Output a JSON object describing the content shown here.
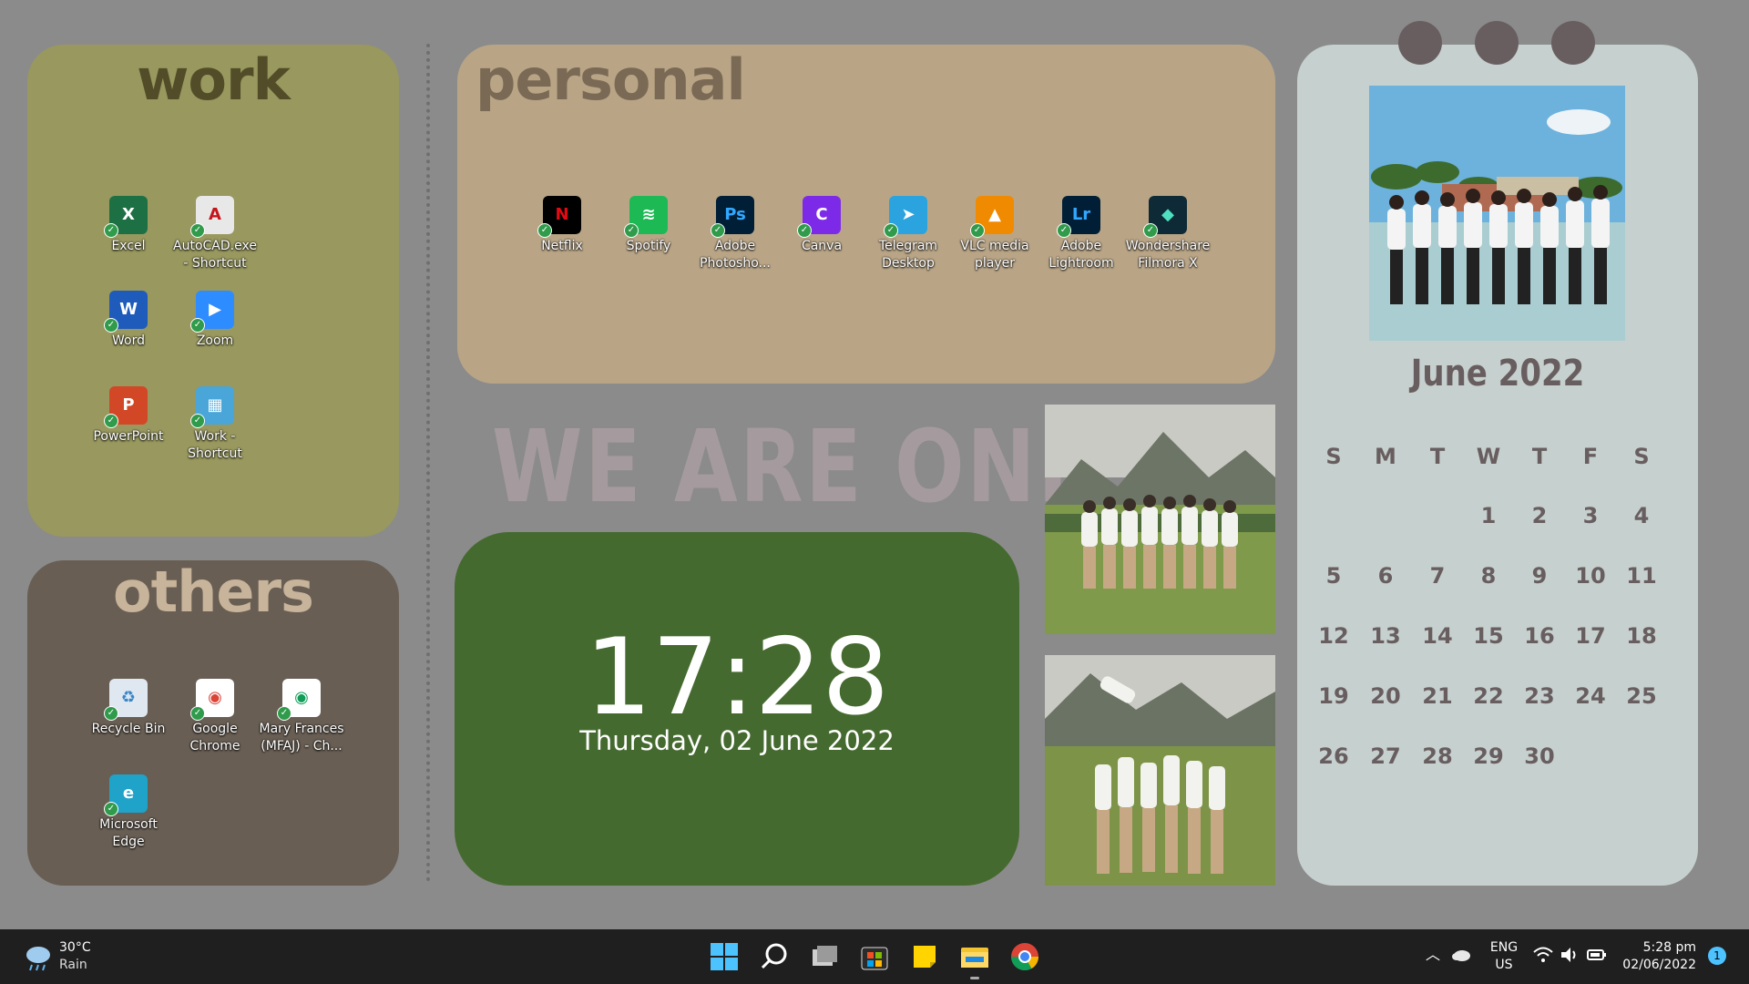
{
  "panels": {
    "work": {
      "title": "work",
      "icons": [
        {
          "label": "Excel",
          "glyph": "X",
          "color": "#1d7044",
          "name": "excel"
        },
        {
          "label": "AutoCAD.exe\n- Shortcut",
          "glyph": "A",
          "color": "#e8e8e8",
          "fg": "#c4161c",
          "name": "autocad"
        },
        {
          "label": "Word",
          "glyph": "W",
          "color": "#1e5bbb",
          "name": "word"
        },
        {
          "label": "Zoom",
          "glyph": "▶",
          "color": "#2d8cff",
          "name": "zoom"
        },
        {
          "label": "PowerPoint",
          "glyph": "P",
          "color": "#d24726",
          "name": "powerpoint"
        },
        {
          "label": "Work -\nShortcut",
          "glyph": "▦",
          "color": "#4aa6d8",
          "name": "work-shortcut"
        }
      ]
    },
    "others": {
      "title": "others",
      "icons": [
        {
          "label": "Recycle Bin",
          "glyph": "♻",
          "color": "#dfe8f0",
          "fg": "#3a87c7",
          "name": "recycle-bin"
        },
        {
          "label": "Google\nChrome",
          "glyph": "◉",
          "color": "#ffffff",
          "fg": "#db4437",
          "name": "google-chrome"
        },
        {
          "label": "Mary Frances\n(MFAJ) - Ch...",
          "glyph": "◉",
          "color": "#ffffff",
          "fg": "#0f9d58",
          "name": "chrome-profile"
        },
        {
          "label": "Microsoft\nEdge",
          "glyph": "e",
          "color": "#1fa3c9",
          "name": "microsoft-edge"
        }
      ]
    },
    "personal": {
      "title": "personal",
      "icons": [
        {
          "label": "Netflix",
          "glyph": "N",
          "color": "#000000",
          "fg": "#e50914",
          "name": "netflix"
        },
        {
          "label": "Spotify",
          "glyph": "≋",
          "color": "#1db954",
          "name": "spotify"
        },
        {
          "label": "Adobe\nPhotosho...",
          "glyph": "Ps",
          "color": "#001e36",
          "fg": "#31a8ff",
          "name": "photoshop"
        },
        {
          "label": "Canva",
          "glyph": "C",
          "color": "#7d2ae8",
          "name": "canva"
        },
        {
          "label": "Telegram\nDesktop",
          "glyph": "➤",
          "color": "#2aa3df",
          "name": "telegram"
        },
        {
          "label": "VLC media\nplayer",
          "glyph": "▲",
          "color": "#f08a00",
          "name": "vlc"
        },
        {
          "label": "Adobe\nLightroom",
          "glyph": "Lr",
          "color": "#001e36",
          "fg": "#31a8ff",
          "name": "lightroom"
        },
        {
          "label": "Wondershare\nFilmora X",
          "glyph": "◆",
          "color": "#0e2a36",
          "fg": "#4fe0c0",
          "name": "filmora"
        }
      ]
    }
  },
  "banner": "WE ARE ONE",
  "clock": {
    "time": "17:28",
    "date": "Thursday, 02 June 2022"
  },
  "calendar": {
    "title": "June 2022",
    "weekdays": [
      "S",
      "M",
      "T",
      "W",
      "T",
      "F",
      "S"
    ],
    "first_weekday_index": 3,
    "days_in_month": 30
  },
  "taskbar": {
    "weather": {
      "temp": "30°C",
      "condition": "Rain"
    },
    "apps": [
      "start-icon",
      "search-icon",
      "task-view-icon",
      "store-icon",
      "sticky-notes-icon",
      "file-explorer-icon",
      "chrome-icon"
    ],
    "lang": {
      "line1": "ENG",
      "line2": "US"
    },
    "time": "5:28 pm",
    "date": "02/06/2022",
    "notification_count": "1"
  },
  "colors": {
    "work": "#98985f",
    "others": "#685e53",
    "personal": "#b9a586",
    "clock": "#456a2f",
    "calendar": "#c6d0ce",
    "desktop": "#8b8b8b"
  }
}
